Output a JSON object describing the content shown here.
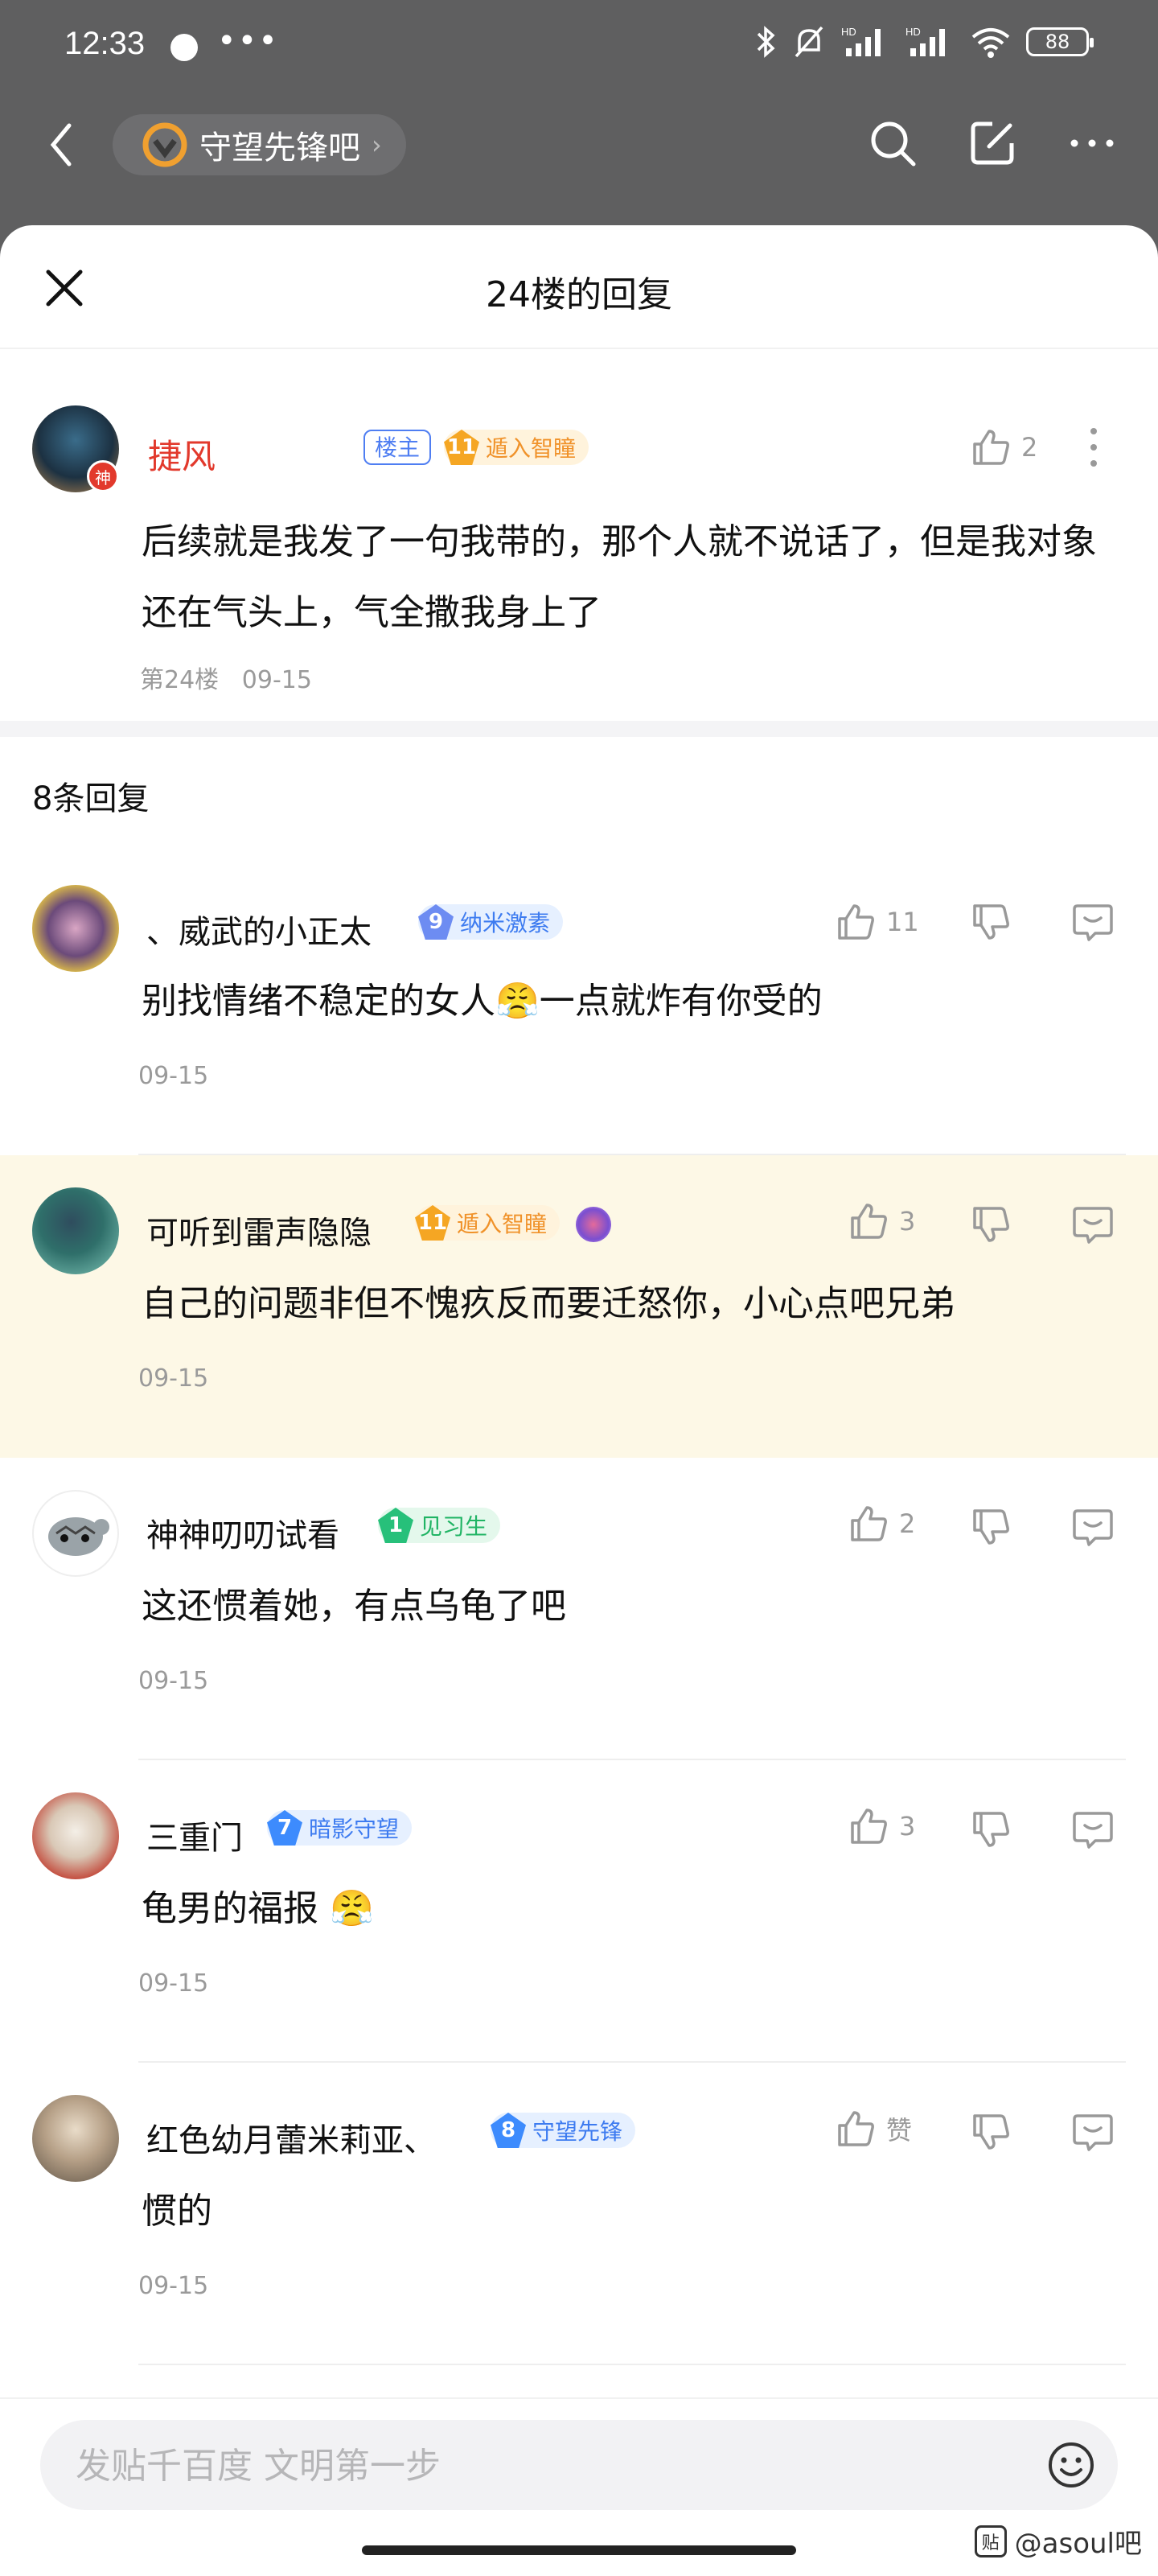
{
  "status_bar": {
    "time": "12:33",
    "battery": "88"
  },
  "nav": {
    "forum_name": "守望先锋吧"
  },
  "sheet": {
    "title": "24楼的回复"
  },
  "op": {
    "name": "捷风",
    "owner_badge": "楼主",
    "level": "11",
    "level_title": "遁入智瞳",
    "likes": "2",
    "god_badge": "神",
    "content": "后续就是我发了一句我带的，那个人就不说话了，但是我对象还在气头上，气全撒我身上了",
    "floor": "第24楼",
    "date": "09-15"
  },
  "reply_count": "8条回复",
  "replies": [
    {
      "name": "、威武的小正太",
      "level": "9",
      "level_title": "纳米激素",
      "likes": "11",
      "text": "别找情绪不稳定的女人",
      "emoji": "😤",
      "text2": "一点就炸有你受的",
      "date": "09-15"
    },
    {
      "name": "可听到雷声隐隐",
      "level": "11",
      "level_title": "遁入智瞳",
      "likes": "3",
      "text": "自己的问题非但不愧疚反而要迁怒你，小心点吧兄弟",
      "date": "09-15"
    },
    {
      "name": "神神叨叨试看",
      "level": "1",
      "level_title": "见习生",
      "likes": "2",
      "text": "这还惯着她，有点乌龟了吧",
      "date": "09-15"
    },
    {
      "name": "三重门",
      "level": "7",
      "level_title": "暗影守望",
      "likes": "3",
      "text": "龟男的福报",
      "emoji": "😤",
      "date": "09-15"
    },
    {
      "name": "红色幼月蕾米莉亚、",
      "level": "8",
      "level_title": "守望先锋",
      "likes": "赞",
      "text": "惯的",
      "date": "09-15"
    }
  ],
  "composer": {
    "placeholder": "发贴千百度 文明第一步"
  },
  "watermark": {
    "text": "@asoul吧",
    "logo": "贴"
  },
  "colors": {
    "accent": "#4f7ef2",
    "owner_red": "#e2392c",
    "level_gold": "#f5a623",
    "level_blue": "#3d8bfd",
    "level_green": "#27c07a",
    "highlight_bg": "#fdf8e6"
  },
  "icons": [
    "back-icon",
    "overwatch-logo-icon",
    "search-icon",
    "edit-icon",
    "more-icon",
    "close-icon",
    "thumb-up-icon",
    "thumb-down-icon",
    "reply-icon",
    "emoji-icon"
  ]
}
